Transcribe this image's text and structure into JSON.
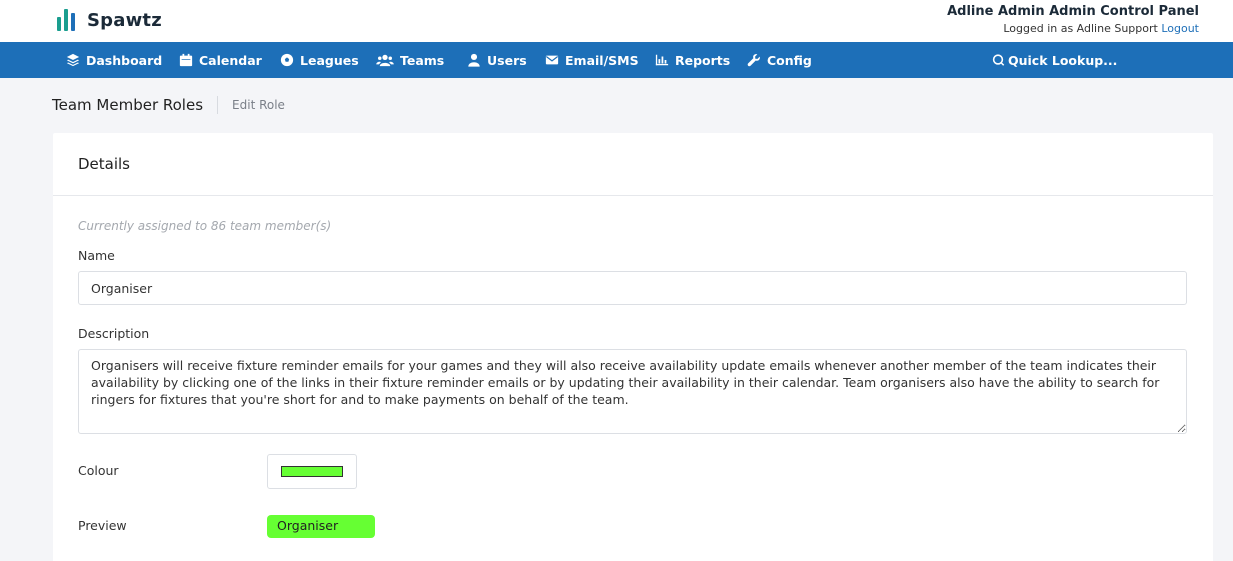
{
  "header": {
    "logo_text": "Spawtz",
    "account_title": "Adline Admin Admin Control Panel",
    "logged_in_prefix": "Logged in as Adline Support",
    "logout_label": "Logout"
  },
  "nav": {
    "dashboard": "Dashboard",
    "calendar": "Calendar",
    "leagues": "Leagues",
    "teams": "Teams",
    "users": "Users",
    "email_sms": "Email/SMS",
    "reports": "Reports",
    "config": "Config",
    "quick_lookup": "Quick Lookup..."
  },
  "breadcrumb": {
    "title": "Team Member Roles",
    "current": "Edit Role"
  },
  "details": {
    "heading": "Details",
    "assigned_note": "Currently assigned to 86 team member(s)",
    "name_label": "Name",
    "name_value": "Organiser",
    "description_label": "Description",
    "description_value": "Organisers will receive fixture reminder emails for your games and they will also receive availability update emails whenever another member of the team indicates their availability by clicking one of the links in their fixture reminder emails or by updating their availability in their calendar. Team organisers also have the ability to search for ringers for fixtures that you're short for and to make payments on behalf of the team.",
    "colour_label": "Colour",
    "colour_value": "#66ff33",
    "preview_label": "Preview",
    "preview_text": "Organiser"
  },
  "colors": {
    "nav_bg": "#1d6fb8",
    "brand_teal": "#1a9e8f",
    "link": "#1e6fb8"
  }
}
